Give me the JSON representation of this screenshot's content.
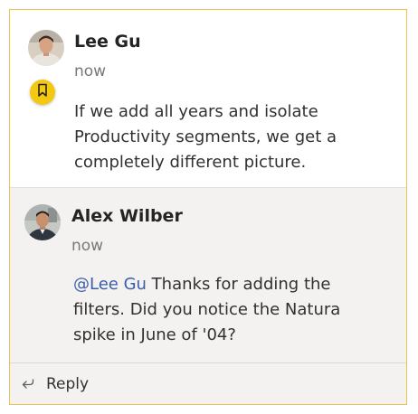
{
  "comments": [
    {
      "author": "Lee Gu",
      "time": "now",
      "text": "If we add all years and isolate Productivity segments, we get a completely different picture.",
      "badge_icon": "bookmark-icon"
    },
    {
      "author": "Alex Wilber",
      "time": "now",
      "mention": "@Lee Gu",
      "text": " Thanks for adding the filters. Did you notice the Natura spike in June of '04?"
    }
  ],
  "footer": {
    "reply_label": "Reply",
    "reply_icon": "reply-icon"
  },
  "colors": {
    "card_border": "#e6c550",
    "badge": "#f2c811",
    "mention": "#3a5ea8",
    "reply_background": "#f3f2f1"
  }
}
